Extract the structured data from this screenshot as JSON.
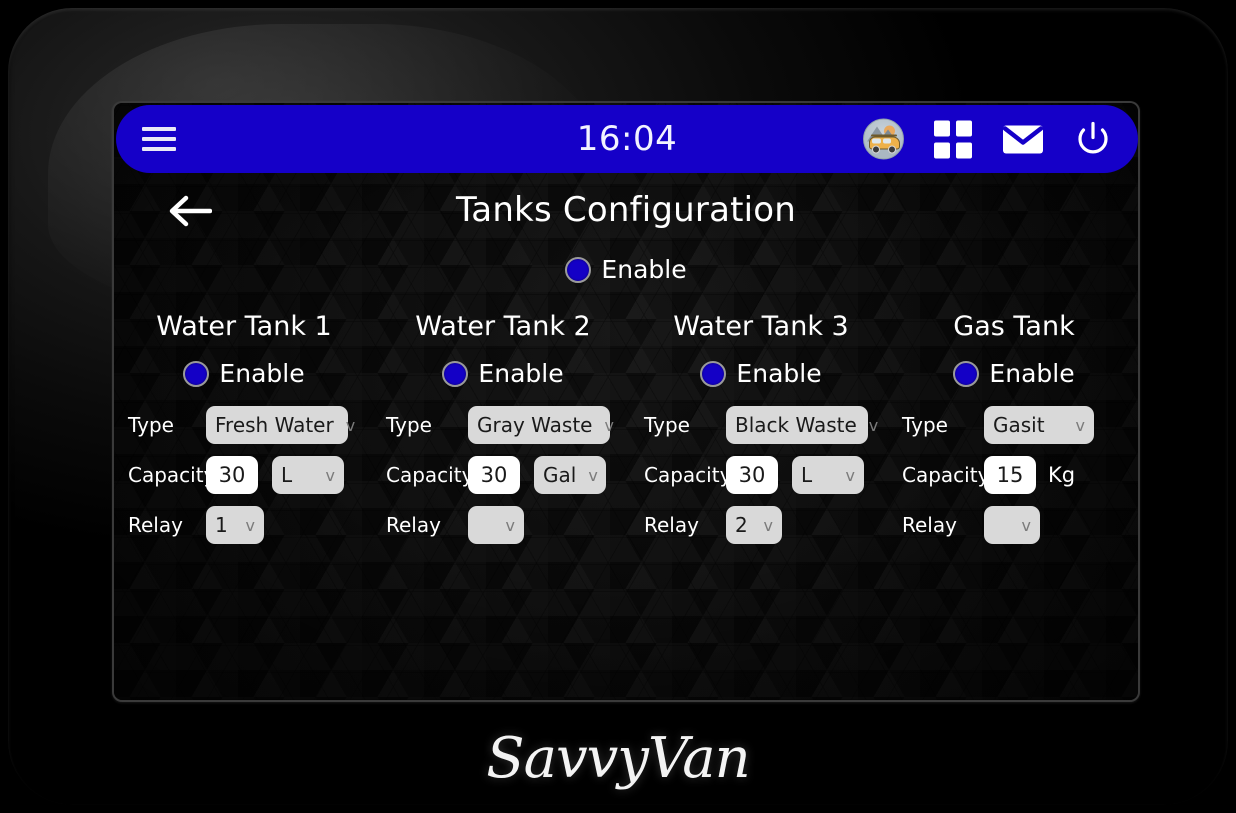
{
  "statusbar": {
    "clock": "16:04",
    "menu_icon": "hamburger-menu-icon",
    "app_logo_icon": "van-logo-icon",
    "apps_icon": "grid-apps-icon",
    "mail_icon": "envelope-mail-icon",
    "power_icon": "power-icon",
    "bar_color": "#1500c8"
  },
  "page": {
    "back_icon": "back-arrow-icon",
    "title": "Tanks Configuration",
    "master_enable_label": "Enable",
    "accent_color": "#1400c6"
  },
  "labels": {
    "type": "Type",
    "capacity": "Capacity",
    "relay": "Relay",
    "enable": "Enable",
    "chevron": "v"
  },
  "tanks": [
    {
      "title": "Water Tank 1",
      "enable_label": "Enable",
      "type_label": "Type",
      "type_value": "Fresh Water",
      "capacity_label": "Capacity",
      "capacity_value": "30",
      "unit_value": "L",
      "unit_is_select": true,
      "relay_label": "Relay",
      "relay_value": "1"
    },
    {
      "title": "Water Tank 2",
      "enable_label": "Enable",
      "type_label": "Type",
      "type_value": "Gray Waste",
      "capacity_label": "Capacity",
      "capacity_value": "30",
      "unit_value": "Gal",
      "unit_is_select": true,
      "relay_label": "Relay",
      "relay_value": ""
    },
    {
      "title": "Water Tank 3",
      "enable_label": "Enable",
      "type_label": "Type",
      "type_value": "Black Waste",
      "capacity_label": "Capacity",
      "capacity_value": "30",
      "unit_value": "L",
      "unit_is_select": true,
      "relay_label": "Relay",
      "relay_value": "2"
    },
    {
      "title": "Gas Tank",
      "enable_label": "Enable",
      "type_label": "Type",
      "type_value": "Gasit",
      "capacity_label": "Capacity",
      "capacity_value": "15",
      "unit_value": "Kg",
      "unit_is_select": false,
      "relay_label": "Relay",
      "relay_value": ""
    }
  ],
  "brand": {
    "name": "SavvyVan"
  }
}
